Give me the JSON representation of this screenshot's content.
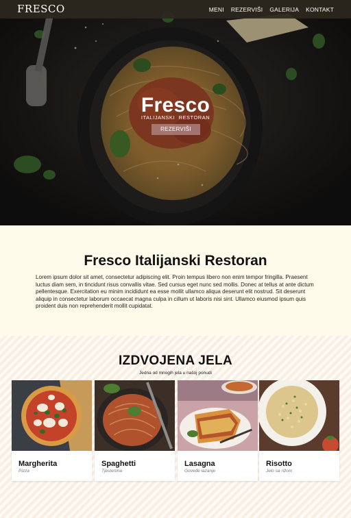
{
  "nav": {
    "logo": "FRESCO",
    "items": [
      "MENI",
      "REZERVIŠI",
      "GALERIJA",
      "KONTAKT"
    ]
  },
  "hero": {
    "title": "Fresco",
    "subtitle": "ITALIJANSKI RESTORAN",
    "button": "REZERVIŠI",
    "image": "spaghetti-plate-photo"
  },
  "about": {
    "heading": "Fresco Italijanski Restoran",
    "text": "Lorem ipsum dolor sit amet, consectetur adipiscing elit. Proin tempus libero non enim tempor fringilla. Praesent luctus diam sem, in tincidunt risus convallis vitae. Sed cursus eget nunc sed mollis. Donec at tellus at ante dictum pellentesque. Exercitation eu minim incididunt ea esse mollit ullamco aliqua deserunt elit nostrud. Sit deserunt aliquip in consectetur laborum occaecat magna culpa in cillum ut laboris nisi sint. Ullamco eiusmod ipsum quis proident duis non reprehenderit mollit cupidatat."
  },
  "featured": {
    "heading": "IZDVOJENA JELA",
    "subtitle": "Jedna od mnogih jela u našoj ponudi",
    "dishes": [
      {
        "name": "Margherita",
        "desc": "Pizza",
        "image": "pizza-photo"
      },
      {
        "name": "Spaghetti",
        "desc": "Tjestenina",
        "image": "spaghetti-photo"
      },
      {
        "name": "Lasagna",
        "desc": "Goveđe lazanje",
        "image": "lasagna-photo"
      },
      {
        "name": "Risotto",
        "desc": "Jelo sa rižom",
        "image": "risotto-photo"
      }
    ]
  },
  "colors": {
    "nav_bg": "#2c281e",
    "about_bg": "#fffbea",
    "featured_bg": "#fcf4ea",
    "button_bg": "#b48c8c"
  }
}
